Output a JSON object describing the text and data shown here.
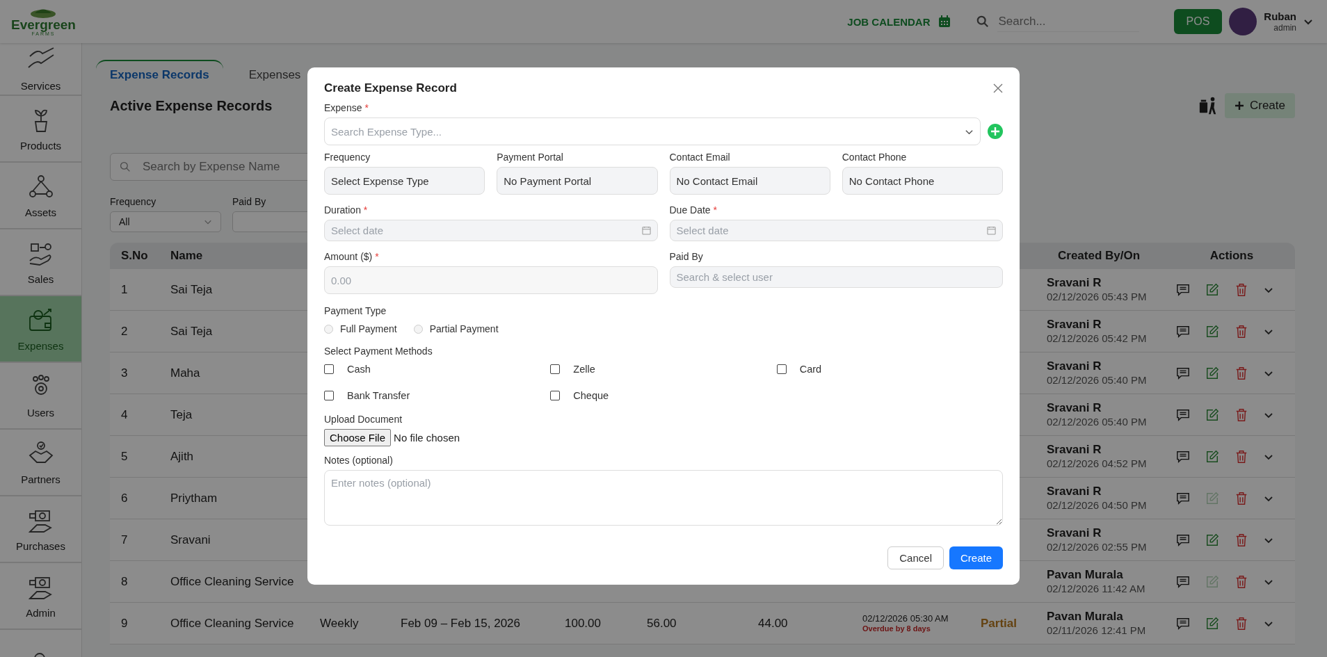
{
  "header": {
    "logo": {
      "name": "Evergreen",
      "tagline": "FARMS"
    },
    "job_calendar": "JOB CALENDAR",
    "search": {
      "placeholder": "Search..."
    },
    "pos_button": "POS",
    "user": {
      "name": "Ruban",
      "role": "admin"
    }
  },
  "sidebar": {
    "items": [
      {
        "kind": "services",
        "label": "Services",
        "selected": false
      },
      {
        "kind": "products",
        "label": "Products",
        "selected": false
      },
      {
        "kind": "assets",
        "label": "Assets",
        "selected": false
      },
      {
        "kind": "sales",
        "label": "Sales",
        "selected": false
      },
      {
        "kind": "expenses",
        "label": "Expenses",
        "selected": true
      },
      {
        "kind": "users",
        "label": "Users",
        "selected": false
      },
      {
        "kind": "partners",
        "label": "Partners",
        "selected": false
      },
      {
        "kind": "purchases",
        "label": "Purchases",
        "selected": false
      },
      {
        "kind": "admin",
        "label": "Admin",
        "selected": false
      },
      {
        "kind": "support",
        "selected": false
      }
    ]
  },
  "tabs": [
    {
      "label": "Expense Records",
      "selected": true
    },
    {
      "label": "Expenses",
      "selected": false
    }
  ],
  "page_title": "Active Expense Records",
  "create_button": "Create",
  "search": {
    "placeholder": "Search by Expense Name"
  },
  "filters": [
    {
      "label": "Frequency",
      "value": "All"
    },
    {
      "label": "Paid By"
    }
  ],
  "table": {
    "columns": [
      "S.No",
      "Name",
      "",
      "",
      "",
      "",
      "",
      "",
      "",
      "Created By/On",
      "Actions"
    ],
    "rows": [
      {
        "sno": "1",
        "name": "Sai Teja",
        "created_by": "Sravani R",
        "created_on": "02/12/2026 05:43 PM",
        "edit_disabled": false
      },
      {
        "sno": "2",
        "name": "Sai Teja",
        "created_by": "Sravani R",
        "created_on": "02/12/2026 05:42 PM",
        "edit_disabled": false
      },
      {
        "sno": "3",
        "name": "Maha",
        "created_by": "Sravani R",
        "created_on": "02/12/2026 05:40 PM",
        "edit_disabled": false
      },
      {
        "sno": "4",
        "name": "Teja",
        "created_by": "Sravani R",
        "created_on": "02/12/2026 05:40 PM",
        "edit_disabled": false
      },
      {
        "sno": "5",
        "name": "Ajith",
        "created_by": "Sravani R",
        "created_on": "02/12/2026 04:52 PM",
        "edit_disabled": false
      },
      {
        "sno": "6",
        "name": "Priytham",
        "created_by": "Sravani R",
        "created_on": "02/12/2026 04:50 PM",
        "edit_disabled": true
      },
      {
        "sno": "7",
        "name": "Sravani",
        "created_by": "Sravani R",
        "created_on": "02/12/2026 02:55 PM",
        "edit_disabled": false
      },
      {
        "sno": "8",
        "name": "Office Cleaning Service",
        "created_by": "Pavan Murala",
        "created_on": "02/12/2026 11:42 AM",
        "edit_disabled": true
      },
      {
        "sno": "9",
        "name": "Office Cleaning Service",
        "frequency": "Weekly",
        "duration": "Feb 09 – Feb 15, 2026",
        "amount": "100.00",
        "paid": "56.00",
        "balance": "44.00",
        "due": "02/12/2026 05:30 AM",
        "overdue": "Overdue by 8 days",
        "status": "Partial",
        "created_by": "Pavan Murala",
        "created_on": "02/11/2026 12:41 PM",
        "edit_disabled": false
      }
    ]
  },
  "modal": {
    "title": "Create Expense Record",
    "expense": {
      "label": "Expense",
      "required_mark": "*",
      "placeholder": "Search Expense Type..."
    },
    "info_fields": [
      {
        "label": "Frequency",
        "value": "Select Expense Type"
      },
      {
        "label": "Payment Portal",
        "value": "No Payment Portal"
      },
      {
        "label": "Contact Email",
        "value": "No Contact Email"
      },
      {
        "label": "Contact Phone",
        "value": "No Contact Phone"
      }
    ],
    "date_fields": [
      {
        "label": "Duration",
        "required_mark": "*",
        "placeholder": "Select date"
      },
      {
        "label": "Due Date",
        "required_mark": "*",
        "placeholder": "Select date"
      }
    ],
    "amount": {
      "label": "Amount ($)",
      "required_mark": "*",
      "placeholder": "0.00"
    },
    "paid_by": {
      "label": "Paid By",
      "placeholder": "Search & select user"
    },
    "payment_type": {
      "label": "Payment Type",
      "options": [
        {
          "label": "Full Payment",
          "selected": false
        },
        {
          "label": "Partial Payment",
          "selected": false
        }
      ]
    },
    "payment_methods": {
      "label": "Select Payment Methods",
      "options": [
        {
          "label": "Cash",
          "checked": false
        },
        {
          "label": "Zelle",
          "checked": false
        },
        {
          "label": "Card",
          "checked": false
        },
        {
          "label": "Bank Transfer",
          "checked": false
        },
        {
          "label": "Cheque",
          "checked": false
        }
      ]
    },
    "upload": {
      "label": "Upload Document",
      "button": "Choose File",
      "status": "No file chosen"
    },
    "notes": {
      "label": "Notes (optional)",
      "placeholder": "Enter notes (optional)"
    },
    "buttons": {
      "cancel": "Cancel",
      "submit": "Create"
    }
  }
}
